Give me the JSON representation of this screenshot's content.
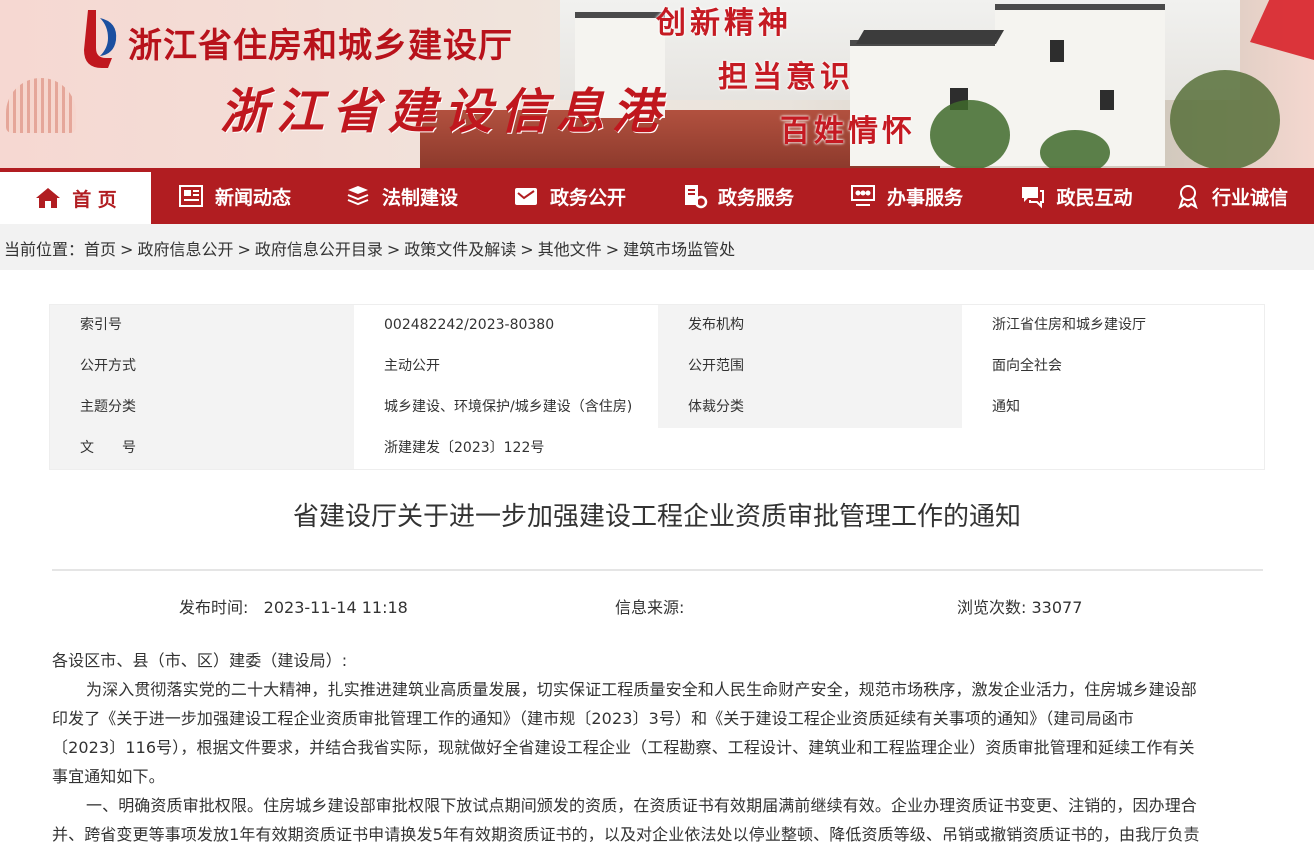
{
  "banner": {
    "org_name": "浙江省住房和城乡建设厅",
    "portal_name": "浙江省建设信息港",
    "slogans": [
      "创新精神",
      "担当意识",
      "百姓情怀"
    ]
  },
  "nav": {
    "items": [
      {
        "label": "首 页",
        "icon": "home-icon"
      },
      {
        "label": "新闻动态",
        "icon": "newspaper-icon"
      },
      {
        "label": "法制建设",
        "icon": "books-icon"
      },
      {
        "label": "政务公开",
        "icon": "mail-icon"
      },
      {
        "label": "政务服务",
        "icon": "document-gear-icon"
      },
      {
        "label": "办事服务",
        "icon": "computer-group-icon"
      },
      {
        "label": "政民互动",
        "icon": "chat-icon"
      },
      {
        "label": "行业诚信",
        "icon": "medal-icon"
      }
    ]
  },
  "breadcrumb": {
    "prefix": "当前位置：",
    "items": [
      "首页",
      "政府信息公开",
      "政府信息公开目录",
      "政策文件及解读",
      "其他文件",
      "建筑市场监管处"
    ],
    "separator": ">"
  },
  "meta": {
    "index_label": "索引号",
    "index_value": "002482242/2023-80380",
    "issuer_label": "发布机构",
    "issuer_value": "浙江省住房和城乡建设厅",
    "open_method_label": "公开方式",
    "open_method_value": "主动公开",
    "open_scope_label": "公开范围",
    "open_scope_value": "面向全社会",
    "topic_label": "主题分类",
    "topic_value": "城乡建设、环境保护/城乡建设（含住房)",
    "genre_label": "体裁分类",
    "genre_value": "通知",
    "doc_no_label": "文　　号",
    "doc_no_value": "浙建建发〔2023〕122号"
  },
  "article": {
    "title": "省建设厅关于进一步加强建设工程企业资质审批管理工作的通知",
    "publish_label": "发布时间:",
    "publish_time": "2023-11-14 11:18",
    "source_label": "信息来源:",
    "source_value": "",
    "views_label": "浏览次数:",
    "views_count": "33077",
    "salutation": "各设区市、县（市、区）建委（建设局）:",
    "para1_line1": "为深入贯彻落实党的二十大精神，扎实推进建筑业高质量发展，切实保证工程质量安全和人民生命财产安全，规范市场秩序，激发企业活力，住房城乡建设部",
    "para1_line2": "印发了《关于进一步加强建设工程企业资质审批管理工作的通知》（建市规〔2023〕3号）和《关于建设工程企业资质延续有关事项的通知》（建司局函市",
    "para1_line3": "〔2023〕116号），根据文件要求，并结合我省实际，现就做好全省建设工程企业（工程勘察、工程设计、建筑业和工程监理企业）资质审批管理和延续工作有关",
    "para1_line4": "事宜通知如下。",
    "para2_line1": "一、明确资质审批权限。住房城乡建设部审批权限下放试点期间颁发的资质，在资质证书有效期届满前继续有效。企业办理资质证书变更、注销的，因办理合",
    "para2_line2": "并、跨省变更等事项发放1年有效期资质证书申请换发5年有效期资质证书的，以及对企业依法处以停业整顿、降低资质等级、吊销或撤销资质证书的，由我厅负责"
  }
}
